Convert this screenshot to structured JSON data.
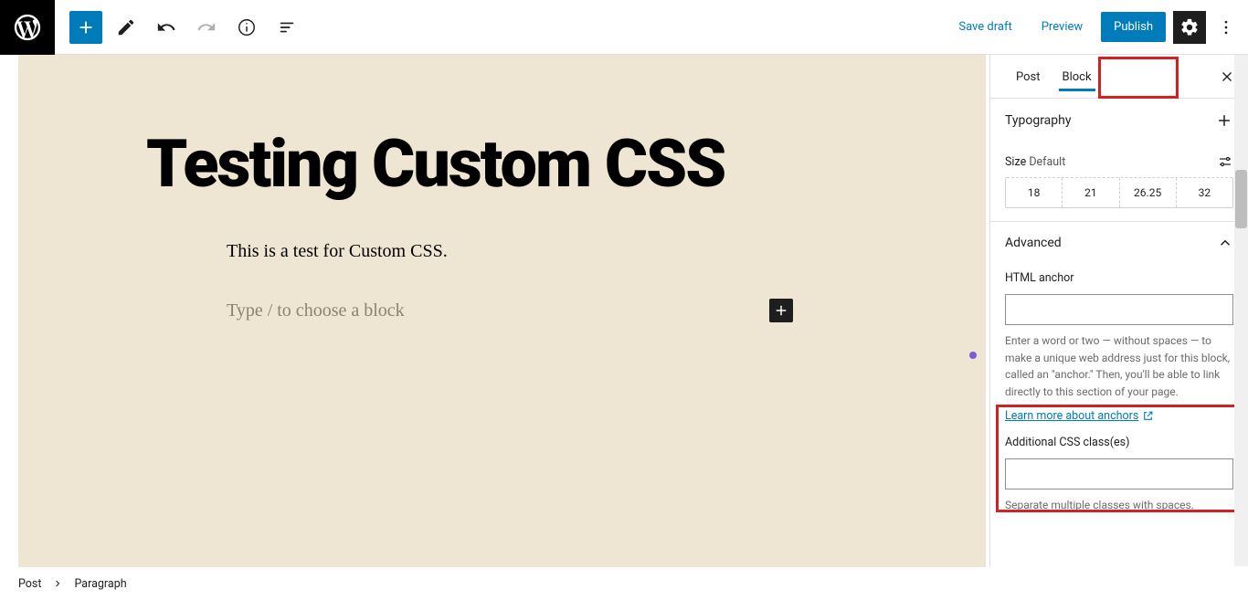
{
  "topbar": {
    "save_draft": "Save draft",
    "preview": "Preview",
    "publish": "Publish"
  },
  "editor": {
    "title": "Testing Custom CSS",
    "paragraph": "This is a test for Custom CSS.",
    "placeholder": "Type / to choose a block"
  },
  "sidebar": {
    "tabs": {
      "post": "Post",
      "block": "Block"
    },
    "typography": {
      "header": "Typography",
      "size_label": "Size",
      "size_default": "Default",
      "options": [
        "18",
        "21",
        "26.25",
        "32"
      ]
    },
    "advanced": {
      "header": "Advanced",
      "anchor_label": "HTML anchor",
      "anchor_help": "Enter a word or two — without spaces — to make a unique web address just for this block, called an \"anchor.\" Then, you'll be able to link directly to this section of your page.",
      "anchor_link": "Learn more about anchors",
      "css_label": "Additional CSS class(es)",
      "css_help": "Separate multiple classes with spaces."
    }
  },
  "breadcrumb": {
    "root": "Post",
    "current": "Paragraph"
  }
}
